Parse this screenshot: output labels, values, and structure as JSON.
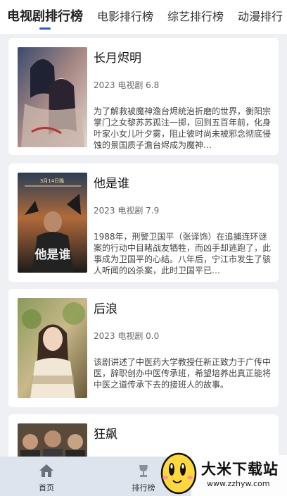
{
  "tabs": [
    {
      "label": "电视剧排行榜",
      "active": true
    },
    {
      "label": "电影排行榜",
      "active": false
    },
    {
      "label": "综艺排行榜",
      "active": false
    },
    {
      "label": "动漫排行",
      "active": false
    }
  ],
  "items": [
    {
      "title": "长月烬明",
      "meta": "2023 电视剧 6.8",
      "description": "为了解救被魔神澹台烬统治折磨的世界，衡阳宗掌门之女黎苏苏孤注一掷，回到五百年前，化身叶家小女儿叶夕雾，阻止彼时尚未被邪念彻底侵蚀的景国质子澹台烬成为魔神…"
    },
    {
      "title": "他是谁",
      "meta": "2023 电视剧 7.9",
      "description": "1988年，刑警卫国平（张译饰）在追捕连环谜案的行动中目睹战友牺牲，而凶手却逃跑了，此事成为卫国平的心结。八年后，宁江市发生了骇人听闻的凶杀案，此时卫国平已…"
    },
    {
      "title": "后浪",
      "meta": "2023 电视剧 0.0",
      "description": "该剧讲述了中医药大学教授任新正致力于广传中医，辞职创办中医传承班，希望培养出真正能将中医之道传承下去的接班人的故事。"
    },
    {
      "title": "狂飙",
      "meta": "",
      "description": ""
    }
  ],
  "poster_texts": {
    "p2_top": "3月14日晚",
    "p2_title": "他是谁"
  },
  "bottom_nav": [
    {
      "label": "首页",
      "icon": "home-icon"
    },
    {
      "label": "排行榜",
      "icon": "trophy-icon"
    }
  ],
  "watermark": {
    "title": "大米下载站",
    "url": "www.zzhyw.com"
  },
  "colors": {
    "accent": "#2f5bd6",
    "background": "#eef0f3",
    "nav_background": "#dde4ee"
  }
}
